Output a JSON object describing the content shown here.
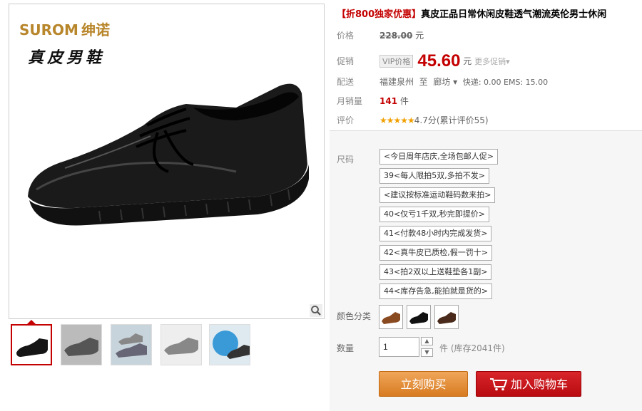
{
  "brand": {
    "name_en": "SUROM",
    "name_cn": "绅诺",
    "tagline": "真皮男鞋"
  },
  "product": {
    "title_prefix": "【折800独家优惠】",
    "title_text": "真皮正品日常休闲皮鞋透气潮流英伦男士休闲",
    "price_label": "价格",
    "original_price": "228.00",
    "currency_unit": "元",
    "promo_label": "促销",
    "vip_tag": "VIP价格",
    "promo_price": "45.60",
    "promo_unit": "元",
    "more_promo": "更多促销",
    "shipping_label": "配送",
    "ship_from": "福建泉州",
    "ship_to_word": "至",
    "ship_to": "廊坊",
    "shipping_fee": "快递: 0.00 EMS: 15.00",
    "monthly_sales_label": "月销量",
    "monthly_sales": "141",
    "monthly_sales_unit": "件",
    "rating_label": "评价",
    "stars": "★★★★★",
    "rating_text": "4.7分(累计评价55)"
  },
  "sku": {
    "label": "尺码",
    "options": [
      "<今日周年店庆,全场包邮人促>",
      "39<每人限拍5双,多拍不发>",
      "<建议按标准运动鞋码数来拍>",
      "40<仅亏1千双,秒完即提价>",
      "41<付款48小时内完成发货>",
      "42<真牛皮已质检,假一罚十>",
      "43<拍2双以上送鞋垫各1副>",
      "44<库存告急,能拍就是货的>"
    ]
  },
  "color": {
    "label": "颜色分类",
    "options": [
      "brown-shoe",
      "black-shoe",
      "dark-brown-shoe"
    ]
  },
  "quantity": {
    "label": "数量",
    "value": "1",
    "stock_text": "件 (库存2041件)"
  },
  "actions": {
    "buy_now": "立刻购买",
    "add_to_cart": "加入购物车"
  },
  "thumbs": [
    "black-shoe-thumb",
    "grey-shoe-thumb",
    "pair-shoe-thumb",
    "side-shoe-thumb",
    "promo-badge-thumb"
  ],
  "colors": {
    "accent_red": "#c40000",
    "buy_orange": "#e08a30",
    "cart_red": "#c9161c",
    "brand_gold": "#b8862b"
  }
}
